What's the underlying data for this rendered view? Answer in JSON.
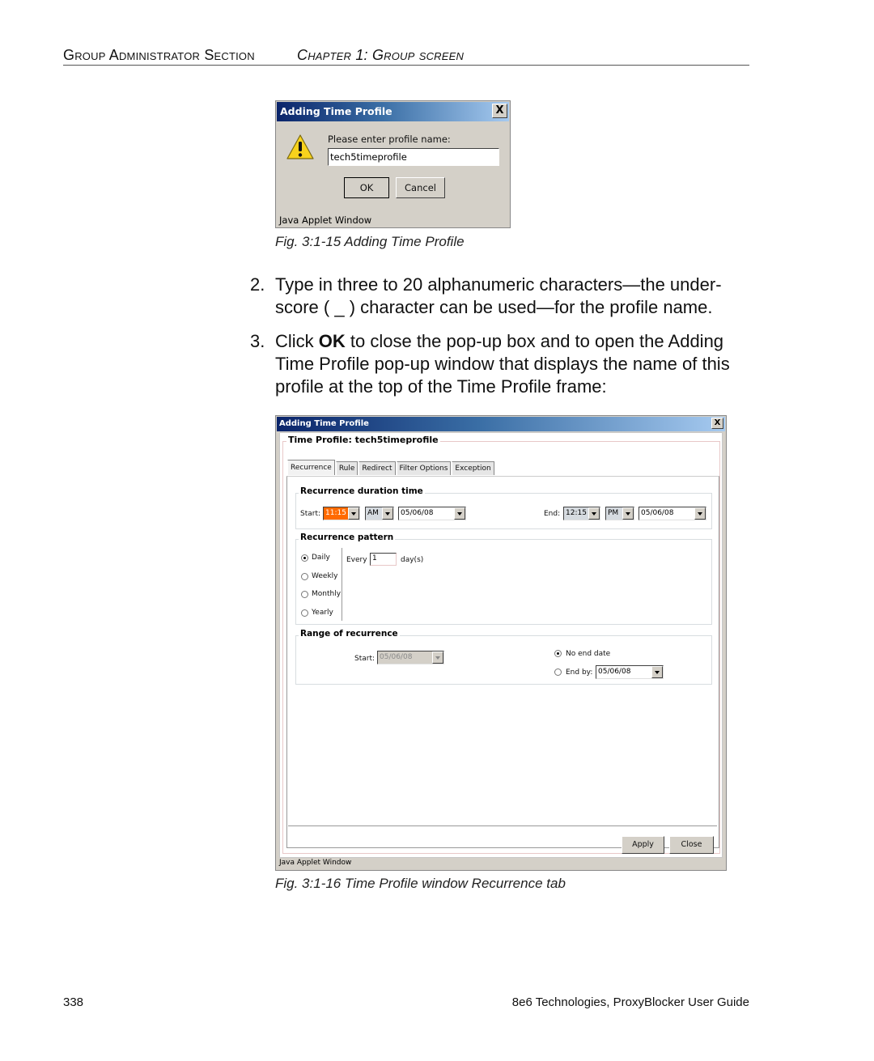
{
  "running_header": {
    "section": "Group Administrator Section",
    "chapter": "Chapter 1: Group screen"
  },
  "figure1": {
    "window_title": "Adding Time Profile",
    "close_glyph": "X",
    "icon": "warning-icon",
    "prompt": "Please enter profile name:",
    "input_value": "tech5timeprofile",
    "ok_label": "OK",
    "cancel_label": "Cancel",
    "status_bar": "Java Applet Window",
    "caption": "Fig. 3:1-15  Adding Time Profile"
  },
  "steps": [
    {
      "number": "2.",
      "text_html": "Type in three to 20 alphanumeric characters—the under-score ( _ ) character can be used—for the profile name."
    },
    {
      "number": "3.",
      "prefix": "Click ",
      "bold": "OK",
      "suffix": " to close the pop-up box and to open the Adding Time Profile pop-up window that displays the name of this profile at the top of the Time Profile frame:"
    }
  ],
  "figure2": {
    "window_title": "Adding Time Profile",
    "close_glyph": "X",
    "frame_title": "Time Profile: tech5timeprofile",
    "tabs": [
      {
        "label": "Recurrence",
        "active": true
      },
      {
        "label": "Rule",
        "active": false
      },
      {
        "label": "Redirect",
        "active": false
      },
      {
        "label": "Filter Options",
        "active": false
      },
      {
        "label": "Exception",
        "active": false
      }
    ],
    "duration": {
      "legend": "Recurrence duration time",
      "start_label": "Start:",
      "start_time": "11:15",
      "start_ampm": "AM",
      "start_date": "05/06/08",
      "end_label": "End:",
      "end_time": "12:15",
      "end_ampm": "PM",
      "end_date": "05/06/08"
    },
    "pattern": {
      "legend": "Recurrence pattern",
      "options": [
        {
          "label": "Daily",
          "selected": true
        },
        {
          "label": "Weekly",
          "selected": false
        },
        {
          "label": "Monthly",
          "selected": false
        },
        {
          "label": "Yearly",
          "selected": false
        }
      ],
      "every_label": "Every",
      "every_value": "1",
      "unit_label": "day(s)"
    },
    "range": {
      "legend": "Range of recurrence",
      "start_label": "Start:",
      "start_date": "05/06/08",
      "no_end_label": "No end date",
      "no_end_selected": true,
      "end_by_label": "End by:",
      "end_by_date": "05/06/08"
    },
    "apply_label": "Apply",
    "close_label": "Close",
    "status_bar": "Java Applet Window",
    "caption": "Fig. 3:1-16  Time Profile window Recurrence tab"
  },
  "footer": {
    "page_number": "338",
    "guide_title": "8e6 Technologies, ProxyBlocker User Guide"
  }
}
